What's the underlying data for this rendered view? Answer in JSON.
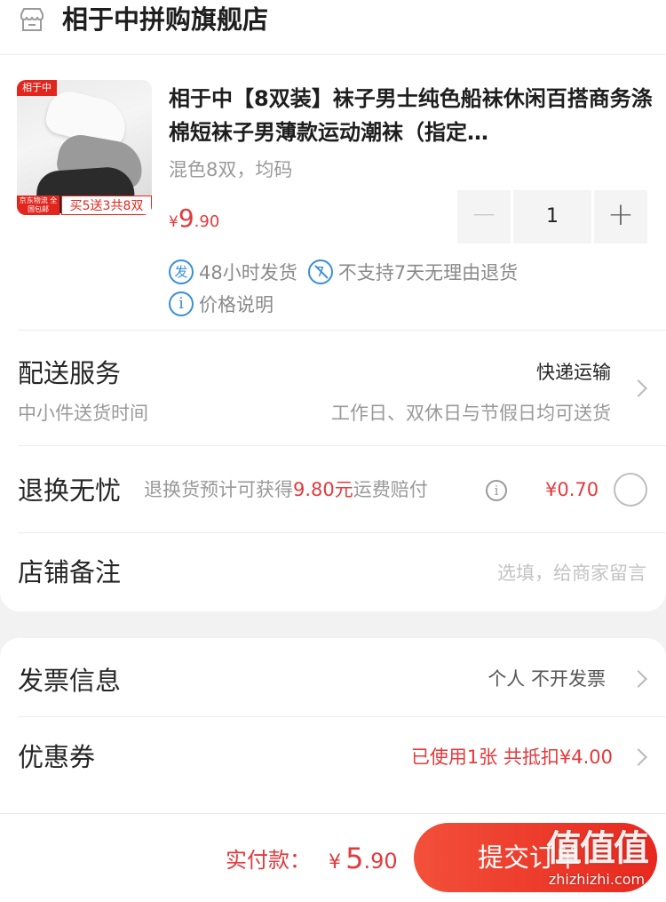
{
  "store": {
    "name": "相于中拼购旗舰店",
    "icon": "store-icon"
  },
  "product": {
    "title": "相于中【8双装】袜子男士纯色船袜休闲百搭商务涤棉短袜子男薄款运动潮袜（指定…",
    "spec": "混色8双，均码",
    "price": {
      "currency": "¥",
      "integer": "9",
      "decimal": ".90"
    },
    "quantity": "1",
    "image_text": {
      "brand_tag": "相于中",
      "left_tag": "京东物流 全国包邮",
      "right_tag": "买5送3共8双"
    },
    "badges": [
      {
        "icon_char": "发",
        "text": "48小时发货"
      },
      {
        "icon_char": "7",
        "text": "不支持7天无理由退货"
      },
      {
        "icon_char": "i",
        "text": "价格说明"
      }
    ]
  },
  "delivery": {
    "label": "配送服务",
    "sub": "中小件送货时间",
    "method": "快递运输",
    "time_desc": "工作日、双休日与节假日均可送货"
  },
  "return_service": {
    "label": "退换无忧",
    "desc_prefix": "退换货预计可获得",
    "desc_amount": "9.80元",
    "desc_suffix": "运费赔付",
    "price": "¥0.70",
    "checked": false
  },
  "remark": {
    "label": "店铺备注",
    "placeholder": "选填，给商家留言"
  },
  "invoice": {
    "label": "发票信息",
    "value": "个人 不开发票"
  },
  "coupon": {
    "label": "优惠券",
    "value": "已使用1张 共抵扣¥4.00"
  },
  "footer": {
    "pay_label": "实付款：",
    "pay_currency": "¥",
    "pay_integer": "5",
    "pay_decimal": ".90",
    "submit": "提交订单"
  },
  "watermark": {
    "logo_text": "值值值",
    "url": "zhizhizhi.com"
  },
  "colors": {
    "accent_red": "#e4393c",
    "badge_blue": "#3a8fd6",
    "submit_gradient": [
      "#f2503a",
      "#e8281e"
    ]
  }
}
